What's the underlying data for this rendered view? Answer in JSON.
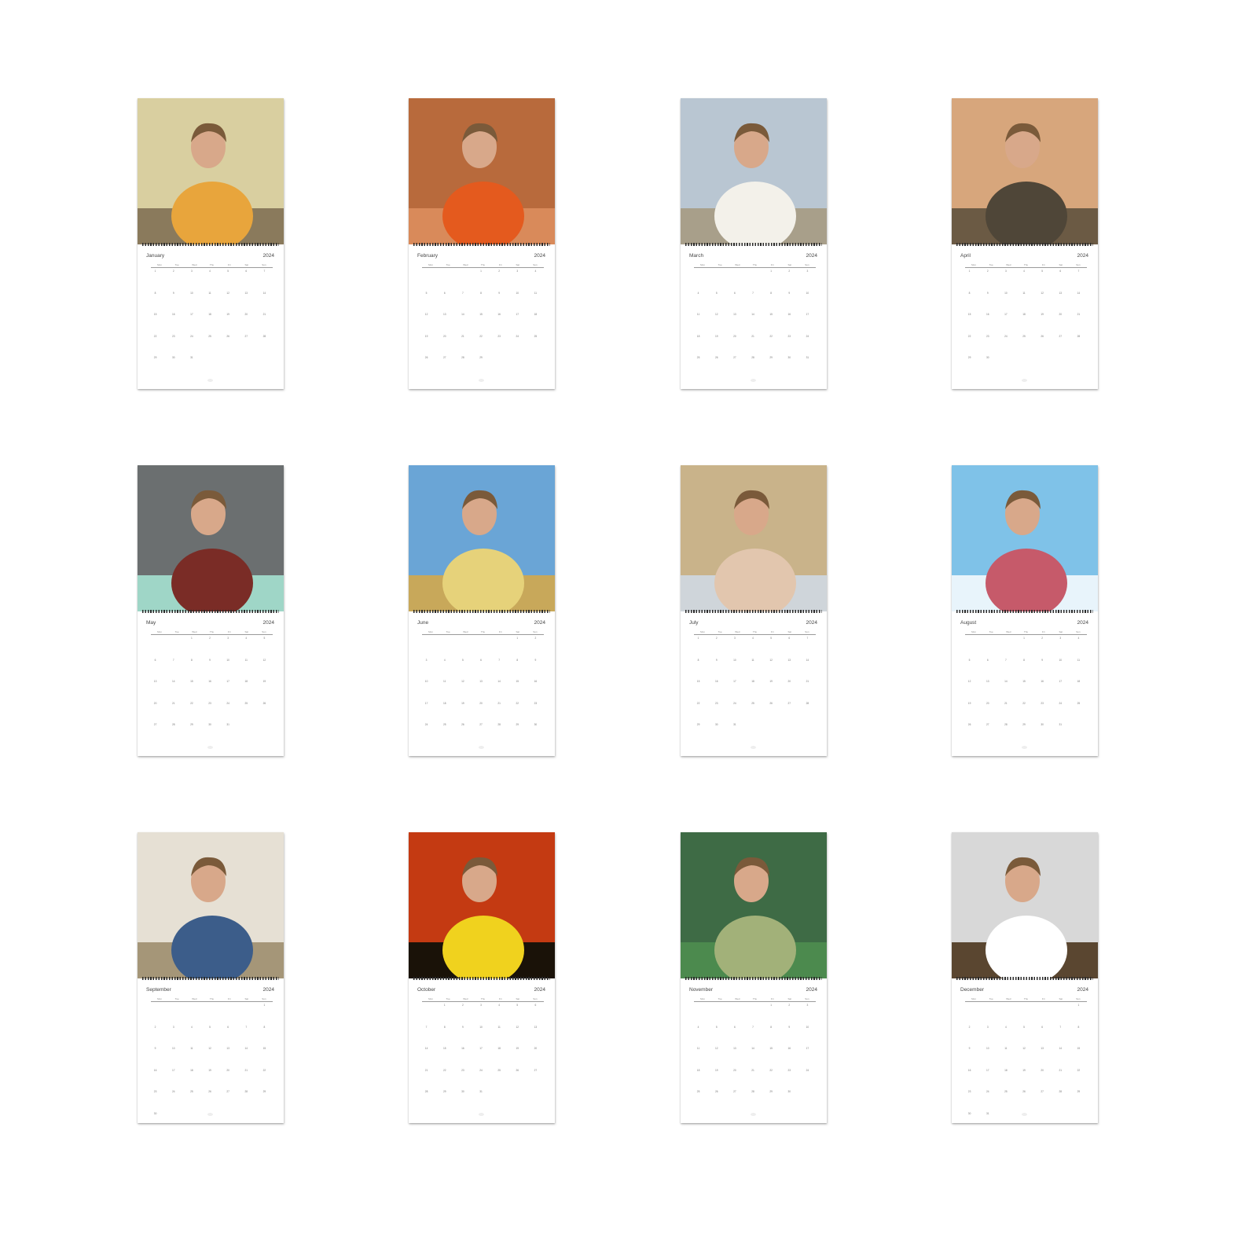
{
  "year": "2024",
  "weekdays": [
    "Mon",
    "Tue",
    "Wed",
    "Thu",
    "Fri",
    "Sat",
    "Sun"
  ],
  "months": [
    {
      "name": "January",
      "offset": 0,
      "days": 31,
      "colors": {
        "bg": "#d9cfa0",
        "figure": "#e8a53c",
        "ground": "#8a7a5c"
      }
    },
    {
      "name": "February",
      "offset": 3,
      "days": 29,
      "colors": {
        "bg": "#b86a3c",
        "figure": "#e45a1e",
        "ground": "#d98a5a"
      }
    },
    {
      "name": "March",
      "offset": 4,
      "days": 31,
      "colors": {
        "bg": "#b9c6d2",
        "figure": "#f3f1ea",
        "ground": "#a89f8a"
      }
    },
    {
      "name": "April",
      "offset": 0,
      "days": 30,
      "colors": {
        "bg": "#d7a67c",
        "figure": "#4f4638",
        "ground": "#6b5a44"
      }
    },
    {
      "name": "May",
      "offset": 2,
      "days": 31,
      "colors": {
        "bg": "#6b6f70",
        "figure": "#7a2c26",
        "ground": "#9fd6c7"
      }
    },
    {
      "name": "June",
      "offset": 5,
      "days": 30,
      "colors": {
        "bg": "#6aa5d6",
        "figure": "#e6d27a",
        "ground": "#c8a85a"
      }
    },
    {
      "name": "July",
      "offset": 0,
      "days": 31,
      "colors": {
        "bg": "#c9b38a",
        "figure": "#e2c6ae",
        "ground": "#cfd5da"
      }
    },
    {
      "name": "August",
      "offset": 3,
      "days": 31,
      "colors": {
        "bg": "#7fc2e8",
        "figure": "#c65a6a",
        "ground": "#e8f4fb"
      }
    },
    {
      "name": "September",
      "offset": 6,
      "days": 30,
      "colors": {
        "bg": "#e6e0d4",
        "figure": "#3c5d8a",
        "ground": "#a59678"
      }
    },
    {
      "name": "October",
      "offset": 1,
      "days": 31,
      "colors": {
        "bg": "#c43a12",
        "figure": "#f0d21e",
        "ground": "#1a1208"
      }
    },
    {
      "name": "November",
      "offset": 4,
      "days": 30,
      "colors": {
        "bg": "#3e6b45",
        "figure": "#a2b179",
        "ground": "#4c8a4e"
      }
    },
    {
      "name": "December",
      "offset": 6,
      "days": 31,
      "colors": {
        "bg": "#d8d8d8",
        "figure": "#ffffff",
        "ground": "#5a4630"
      }
    }
  ]
}
